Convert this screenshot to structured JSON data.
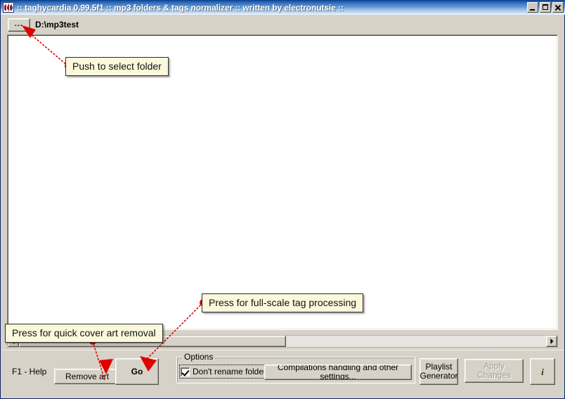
{
  "window": {
    "title": ":: taghycardia 0.99.5f1 :: mp3 folders & tags normalizer :: written by electronutsie ::",
    "icon": "waveform-icon",
    "controls": {
      "minimize": "minimize-icon",
      "maximize": "maximize-icon",
      "close": "close-icon"
    }
  },
  "path_bar": {
    "browse_label": "...",
    "path": "D:\\mp3test"
  },
  "list_area": {
    "items": []
  },
  "scrollbar": {
    "left_arrow": "scroll-left-icon",
    "right_arrow": "scroll-right-icon",
    "orientation": "horizontal"
  },
  "toolbar": {
    "help_hint": "F1 - Help",
    "remove_art_label": "Remove art",
    "go_label": "Go",
    "compilations_label": "Compilations handling and other settings...",
    "playlist_generator_label": "Playlist\nGenerator",
    "apply_changes_label": "Apply Changes",
    "apply_changes_enabled": false,
    "info_label": "i"
  },
  "options": {
    "legend": "Options",
    "dont_rename_label": "Don't rename folders",
    "dont_rename_checked": true
  },
  "annotations": [
    {
      "id": "select-folder",
      "text": "Push to select folder"
    },
    {
      "id": "tag-process",
      "text": "Press for full-scale tag processing"
    },
    {
      "id": "cover-art",
      "text": "Press for quick cover art removal"
    }
  ],
  "colors": {
    "title_bar_start": "#0a3a86",
    "title_bar_end": "#f2f7fd",
    "window_face": "#d6d2c8",
    "list_background": "#ffffff",
    "annotation_fill": "#fbf8dc",
    "annotation_accent": "#e00000"
  }
}
